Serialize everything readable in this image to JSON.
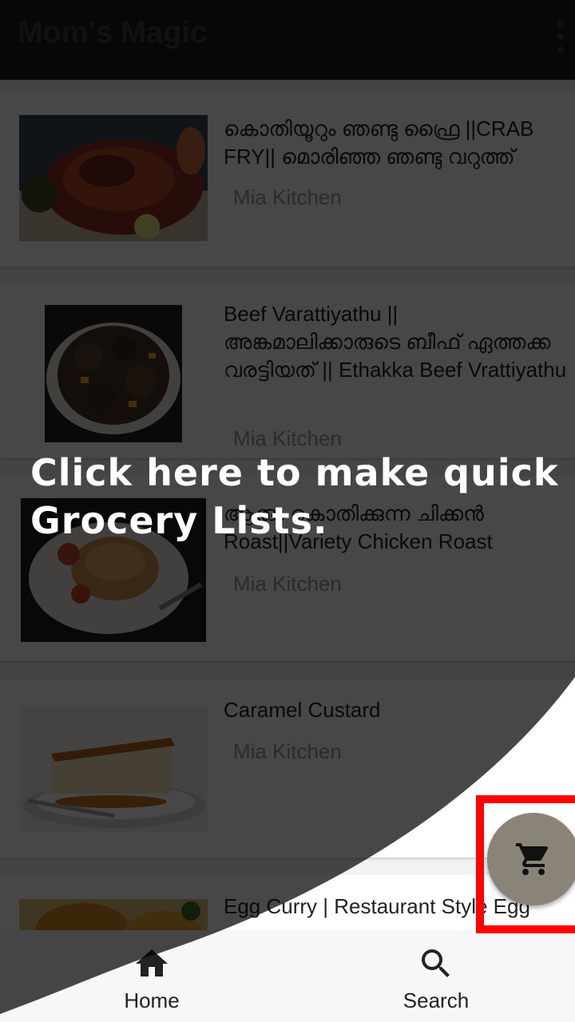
{
  "app": {
    "title": "Mom's Magic"
  },
  "recipes": [
    {
      "title": "കൊതിയൂറും ഞണ്ടു ഫ്രൈ ||CRAB FRY|| മൊരിഞ്ഞ ഞണ്ടു വറുത്ത്",
      "author": "Mia Kitchen"
    },
    {
      "title": "Beef Varattiyathu || അങ്കമാലിക്കാരുടെ ബീഫ് ഏത്തക്ക വരട്ടിയത് || Ethakka Beef Vrattiyathu",
      "author": "Mia Kitchen"
    },
    {
      "title": "ആരും കൊതിക്കുന്ന ചിക്കൻ Roast||Variety Chicken Roast",
      "author": "Mia Kitchen"
    },
    {
      "title": "Caramel Custard",
      "author": "Mia Kitchen"
    },
    {
      "title": "Egg Curry | Restaurant Style Egg",
      "author": ""
    }
  ],
  "coach_mark": {
    "text": "Click here to make quick Grocery Lists."
  },
  "fab": {
    "icon": "cart-icon"
  },
  "bottom_nav": {
    "home": {
      "label": "Home",
      "icon": "home-icon"
    },
    "search": {
      "label": "Search",
      "icon": "search-icon"
    }
  }
}
